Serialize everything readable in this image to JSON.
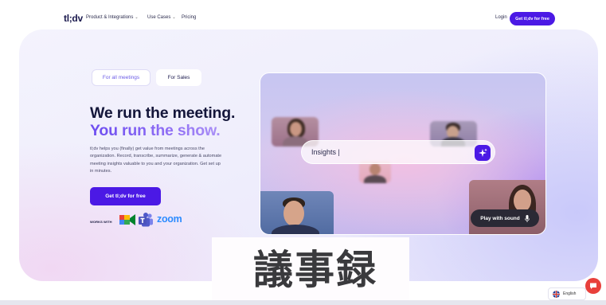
{
  "nav": {
    "logo": "tl;dv",
    "links": [
      {
        "label": "Product & Integrations",
        "has_dropdown": true
      },
      {
        "label": "Use Cases",
        "has_dropdown": true
      },
      {
        "label": "Pricing",
        "has_dropdown": false
      }
    ],
    "login": "Login",
    "cta": "Get tl;dv for free"
  },
  "hero": {
    "tabs": [
      {
        "label": "For all meetings",
        "active": true
      },
      {
        "label": "For Sales",
        "active": false
      }
    ],
    "headline_1": "We run the meeting.",
    "headline_2": "You run the show.",
    "description": "tl;dv helps you (finally) get value from meetings across the organization. Record, transcribe, summarize, generate & automate meeting insights valuable to you and your organization. Get set up in minutes.",
    "cta": "Get tl;dv for free",
    "works_with_label": "WORKS WITH",
    "integrations": [
      "google-meet-icon",
      "microsoft-teams-icon",
      "zoom-logo"
    ],
    "zoom_word": "zoom"
  },
  "video": {
    "search_text": "Insights |",
    "play_label": "Play with sound"
  },
  "overlay": {
    "text": "議事録"
  },
  "footer": {
    "language": "English"
  },
  "colors": {
    "brand": "#4b19e5",
    "headline_gradient_start": "#6c4cf0",
    "zoom_blue": "#2d8cff",
    "chat_red": "#e8403b"
  }
}
